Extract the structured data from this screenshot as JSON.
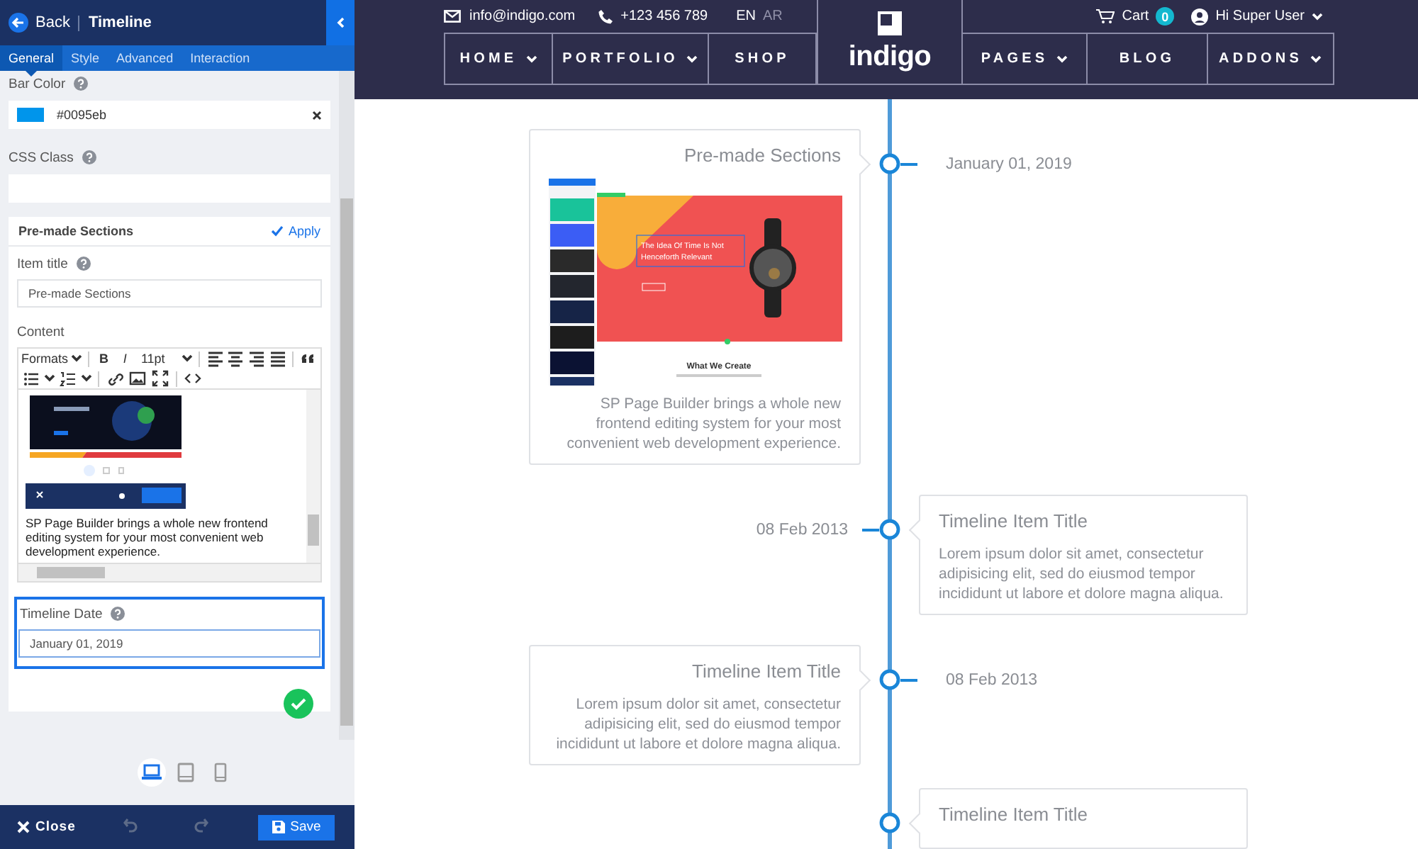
{
  "editor": {
    "back": "Back",
    "title": "Timeline",
    "tabs": [
      {
        "label": "General",
        "selected": true
      },
      {
        "label": "Style",
        "selected": false
      },
      {
        "label": "Advanced",
        "selected": false
      },
      {
        "label": "Interaction",
        "selected": false
      }
    ],
    "bar_color": {
      "label": "Bar Color",
      "value": "#0095eb"
    },
    "css_class": {
      "label": "CSS Class"
    },
    "item": {
      "header": "Pre-made Sections",
      "apply": "Apply",
      "title_label": "Item title",
      "title_value": "Pre-made Sections",
      "content_label": "Content",
      "toolbar": {
        "formats": "Formats",
        "bold": "B",
        "italic": "I",
        "size": "11pt"
      },
      "content_text": "SP Page Builder brings a whole new frontend editing system for your most convenient web development experience.",
      "date_label": "Timeline Date",
      "date_value": "January 01, 2019",
      "date_focused": true
    },
    "devices": [
      {
        "kind": "laptop",
        "selected": true
      },
      {
        "kind": "tablet",
        "selected": false
      },
      {
        "kind": "phone",
        "selected": false
      }
    ],
    "close": "Close",
    "save": "Save"
  },
  "site": {
    "email": "info@indigo.com",
    "phone": "+123 456 789",
    "languages": [
      {
        "label": "EN",
        "selected": true
      },
      {
        "label": "AR",
        "selected": false
      }
    ],
    "logo": "indigo",
    "cart": "Cart",
    "cart_count": "0",
    "user": "Hi Super User",
    "menu": [
      {
        "label": "HOME",
        "dropdown": true
      },
      {
        "label": "PORTFOLIO",
        "dropdown": true
      },
      {
        "label": "SHOP",
        "dropdown": false
      },
      {
        "label": "PAGES",
        "dropdown": true
      },
      {
        "label": "BLOG",
        "dropdown": false
      },
      {
        "label": "ADDONS",
        "dropdown": true
      }
    ]
  },
  "timeline": [
    {
      "kind": "left",
      "title": "Pre-made Sections",
      "screenshot": {
        "headline": "The Idea Of Time Is Not Henceforth Relevant",
        "section": "What We Create"
      },
      "text": "SP Page Builder brings a whole new frontend editing system for your most convenient web development experience.",
      "date": "January 01, 2019"
    },
    {
      "kind": "right",
      "title": "Timeline Item Title",
      "text": "Lorem ipsum dolor sit amet, consectetur adipisicing elit, sed do eiusmod tempor incididunt ut labore et dolore magna aliqua.",
      "date": "08 Feb 2013"
    },
    {
      "kind": "left",
      "title": "Timeline Item Title",
      "text": "Lorem ipsum dolor sit amet, consectetur adipisicing elit, sed do eiusmod tempor incididunt ut labore et dolore magna aliqua.",
      "date": "08 Feb 2013"
    },
    {
      "kind": "right",
      "title": "Timeline Item Title"
    }
  ]
}
